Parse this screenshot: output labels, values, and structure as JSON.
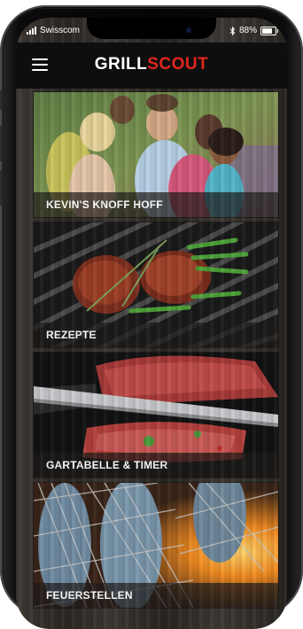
{
  "status": {
    "carrier": "Swisscom",
    "bluetooth_icon": "bluetooth-icon",
    "battery_pct": "88%"
  },
  "header": {
    "logo_part1": "GRILL",
    "logo_part2": "SCOUT",
    "menu_icon": "hamburger-menu-icon"
  },
  "tiles": [
    {
      "label": "KEVIN'S KNOFF HOFF"
    },
    {
      "label": "REZEPTE"
    },
    {
      "label": "GARTABELLE & TIMER"
    },
    {
      "label": "FEUERSTELLEN"
    }
  ],
  "colors": {
    "brand_red": "#e1261c",
    "header_bg": "#0e0e0f"
  }
}
